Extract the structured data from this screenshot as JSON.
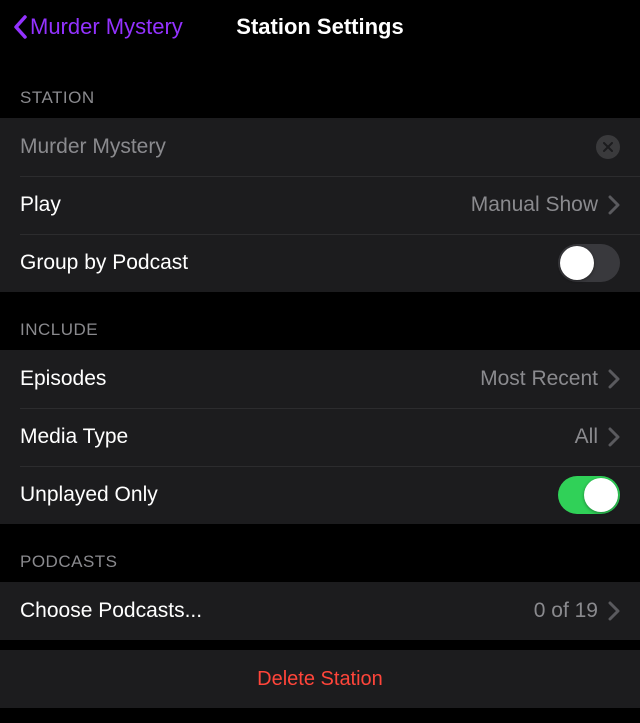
{
  "nav": {
    "back_label": "Murder Mystery",
    "title": "Station Settings"
  },
  "sections": {
    "station": {
      "header": "STATION",
      "name_value": "Murder Mystery",
      "play_label": "Play",
      "play_value": "Manual Show",
      "group_label": "Group by Podcast",
      "group_on": false
    },
    "include": {
      "header": "INCLUDE",
      "episodes_label": "Episodes",
      "episodes_value": "Most Recent",
      "media_label": "Media Type",
      "media_value": "All",
      "unplayed_label": "Unplayed Only",
      "unplayed_on": true
    },
    "podcasts": {
      "header": "PODCASTS",
      "choose_label": "Choose Podcasts...",
      "choose_value": "0 of 19"
    }
  },
  "delete_label": "Delete Station"
}
